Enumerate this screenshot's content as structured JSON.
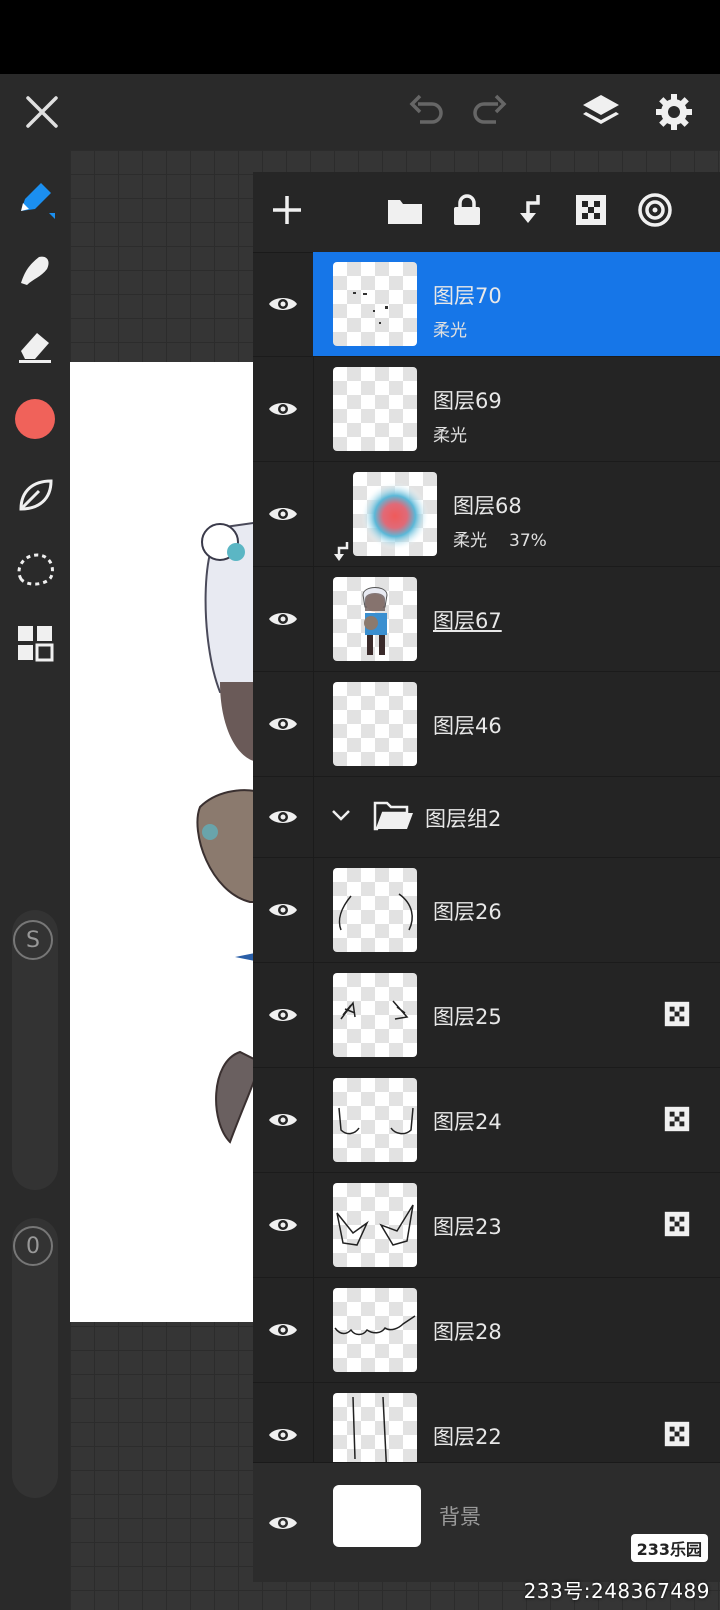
{
  "colors": {
    "accent": "#1676e8",
    "brush_color": "#f0625a"
  },
  "layers": [
    {
      "name": "图层70",
      "mode": "柔光",
      "opacity": "",
      "selected": true,
      "clipped": false,
      "alpha_lock": false
    },
    {
      "name": "图层69",
      "mode": "柔光",
      "opacity": "",
      "selected": false,
      "clipped": false,
      "alpha_lock": false
    },
    {
      "name": "图层68",
      "mode": "柔光",
      "opacity": "37%",
      "selected": false,
      "clipped": true,
      "alpha_lock": false
    },
    {
      "name": "图层67",
      "mode": "",
      "opacity": "",
      "selected": false,
      "clipped": false,
      "alpha_lock": false
    },
    {
      "name": "图层46",
      "mode": "",
      "opacity": "",
      "selected": false,
      "clipped": false,
      "alpha_lock": false
    },
    {
      "name": "图层组2",
      "is_group": true,
      "expanded": true
    },
    {
      "name": "图层26",
      "mode": "",
      "opacity": "",
      "selected": false,
      "clipped": false,
      "alpha_lock": false
    },
    {
      "name": "图层25",
      "mode": "",
      "opacity": "",
      "selected": false,
      "clipped": false,
      "alpha_lock": true
    },
    {
      "name": "图层24",
      "mode": "",
      "opacity": "",
      "selected": false,
      "clipped": false,
      "alpha_lock": true
    },
    {
      "name": "图层23",
      "mode": "",
      "opacity": "",
      "selected": false,
      "clipped": false,
      "alpha_lock": true
    },
    {
      "name": "图层28",
      "mode": "",
      "opacity": "",
      "selected": false,
      "clipped": false,
      "alpha_lock": false
    },
    {
      "name": "图层22",
      "mode": "",
      "opacity": "",
      "selected": false,
      "clipped": false,
      "alpha_lock": true
    }
  ],
  "background_layer": {
    "name": "背景"
  },
  "sliders": {
    "size_label": "S",
    "opacity_label": "0"
  },
  "watermark": {
    "logo": "233乐园",
    "text": "233号:248367489"
  }
}
